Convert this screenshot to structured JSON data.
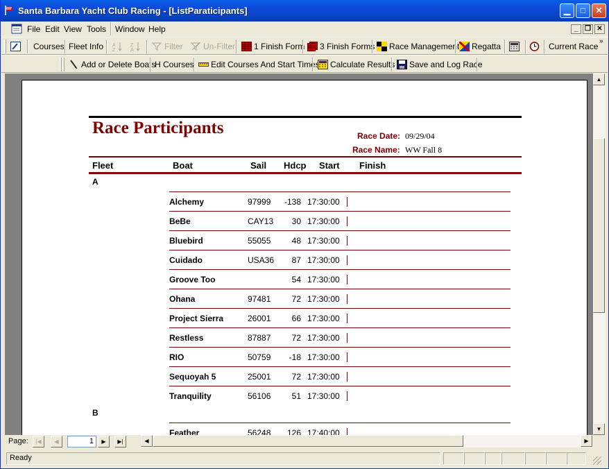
{
  "window": {
    "title": "Santa Barbara Yacht Club Racing - [ListParaticipants]"
  },
  "menu": [
    "File",
    "Edit",
    "View",
    "Tools",
    "Window",
    "Help"
  ],
  "toolbar1": {
    "courses": "Courses",
    "fleet_info": "Fleet Info",
    "filter": "Filter",
    "unfilter": "Un-Filter",
    "finish_form_1": "1 Finish Form",
    "finish_forms_3": "3 Finish Forms",
    "race_management": "Race Management",
    "regatta": "Regatta",
    "current_race": "Current Race"
  },
  "toolbar2": {
    "add_delete_boats": "Add or Delete Boats",
    "h_courses": "H Courses",
    "edit_courses": "Edit Courses And Start Times",
    "calculate_results": "Calculate Results",
    "save_log_race": "Save and Log Race"
  },
  "report": {
    "title": "Race Participants",
    "race_date_label": "Race Date:",
    "race_date": "09/29/04",
    "race_name_label": "Race Name:",
    "race_name": "WW Fall 8",
    "columns": {
      "fleet": "Fleet",
      "boat": "Boat",
      "sail": "Sail",
      "hdcp": "Hdcp",
      "start": "Start",
      "finish": "Finish"
    },
    "fleets": [
      {
        "name": "A",
        "boats": [
          {
            "boat": "Alchemy",
            "sail": "97999",
            "hdcp": "-138",
            "start": "17:30:00"
          },
          {
            "boat": "BeBe",
            "sail": "CAY13",
            "hdcp": "30",
            "start": "17:30:00"
          },
          {
            "boat": "Bluebird",
            "sail": "55055",
            "hdcp": "48",
            "start": "17:30:00"
          },
          {
            "boat": "Cuidado",
            "sail": "USA36",
            "hdcp": "87",
            "start": "17:30:00"
          },
          {
            "boat": "Groove Too",
            "sail": "",
            "hdcp": "54",
            "start": "17:30:00"
          },
          {
            "boat": "Ohana",
            "sail": "97481",
            "hdcp": "72",
            "start": "17:30:00"
          },
          {
            "boat": "Project Sierra",
            "sail": "26001",
            "hdcp": "66",
            "start": "17:30:00"
          },
          {
            "boat": "Restless",
            "sail": "87887",
            "hdcp": "72",
            "start": "17:30:00"
          },
          {
            "boat": "RIO",
            "sail": "50759",
            "hdcp": "-18",
            "start": "17:30:00"
          },
          {
            "boat": "Sequoyah 5",
            "sail": "25001",
            "hdcp": "72",
            "start": "17:30:00"
          },
          {
            "boat": "Tranquility",
            "sail": "56106",
            "hdcp": "51",
            "start": "17:30:00"
          }
        ]
      },
      {
        "name": "B",
        "boats": [
          {
            "boat": "Feather",
            "sail": "56248",
            "hdcp": "126",
            "start": "17:40:00"
          }
        ]
      }
    ]
  },
  "nav": {
    "page_label": "Page:",
    "page": "1"
  },
  "status": {
    "text": "Ready"
  }
}
